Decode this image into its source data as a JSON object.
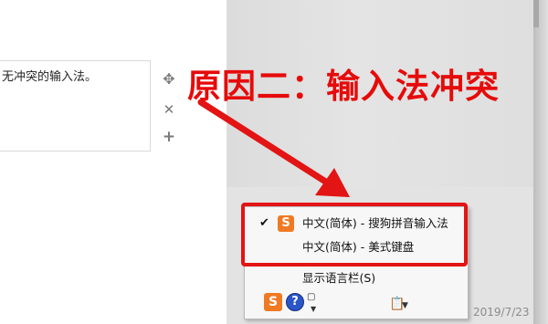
{
  "editor": {
    "text": "无冲突的输入法。"
  },
  "annotation": {
    "text": "原因二：输入法冲突"
  },
  "menu": {
    "items": [
      {
        "label": "中文(简体) - 搜狗拼音输入法",
        "checked": true,
        "icon": "sogou-icon"
      },
      {
        "label": "中文(简体) - 美式键盘",
        "checked": false
      },
      {
        "label": "显示语言栏(S)",
        "checked": false
      }
    ],
    "check_glyph": "✔"
  },
  "tray": {
    "sogou_glyph": "S",
    "help_glyph": "?",
    "date": "2019/7/23"
  },
  "colors": {
    "annotation_red": "#e60b0b",
    "highlight_red": "#e31414",
    "sogou_orange": "#f07a24",
    "help_blue": "#2a55c8"
  }
}
